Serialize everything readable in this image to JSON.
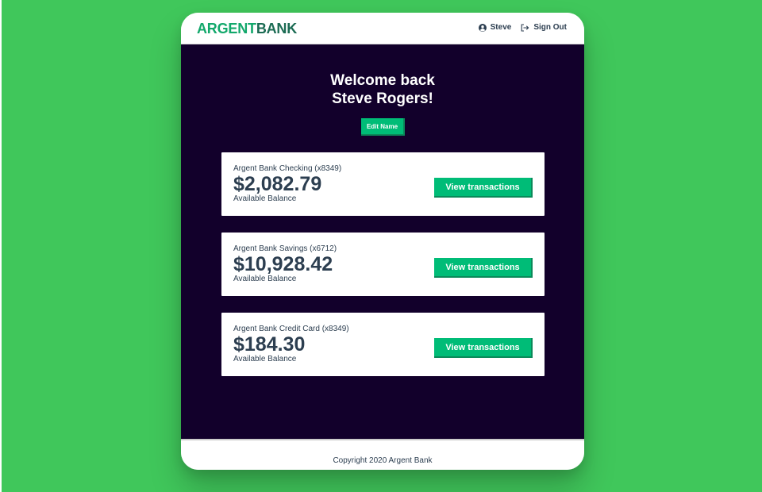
{
  "colors": {
    "background": "#40c75b",
    "main_bg": "#12002b",
    "accent": "#00bc77",
    "text": "#2c3e50"
  },
  "header": {
    "logo_part1": "ARGENT",
    "logo_part2": "BANK",
    "user_icon": "user-circle-icon",
    "user_name": "Steve",
    "signout_icon": "sign-out-icon",
    "signout_label": "Sign Out"
  },
  "main": {
    "welcome_line1": "Welcome back",
    "welcome_line2": "Steve Rogers!",
    "edit_button_label": "Edit Name",
    "accounts": [
      {
        "title": "Argent Bank Checking (x8349)",
        "amount": "$2,082.79",
        "description": "Available Balance",
        "button_label": "View transactions"
      },
      {
        "title": "Argent Bank Savings (x6712)",
        "amount": "$10,928.42",
        "description": "Available Balance",
        "button_label": "View transactions"
      },
      {
        "title": "Argent Bank Credit Card (x8349)",
        "amount": "$184.30",
        "description": "Available Balance",
        "button_label": "View transactions"
      }
    ]
  },
  "footer": {
    "text": "Copyright 2020 Argent Bank"
  }
}
